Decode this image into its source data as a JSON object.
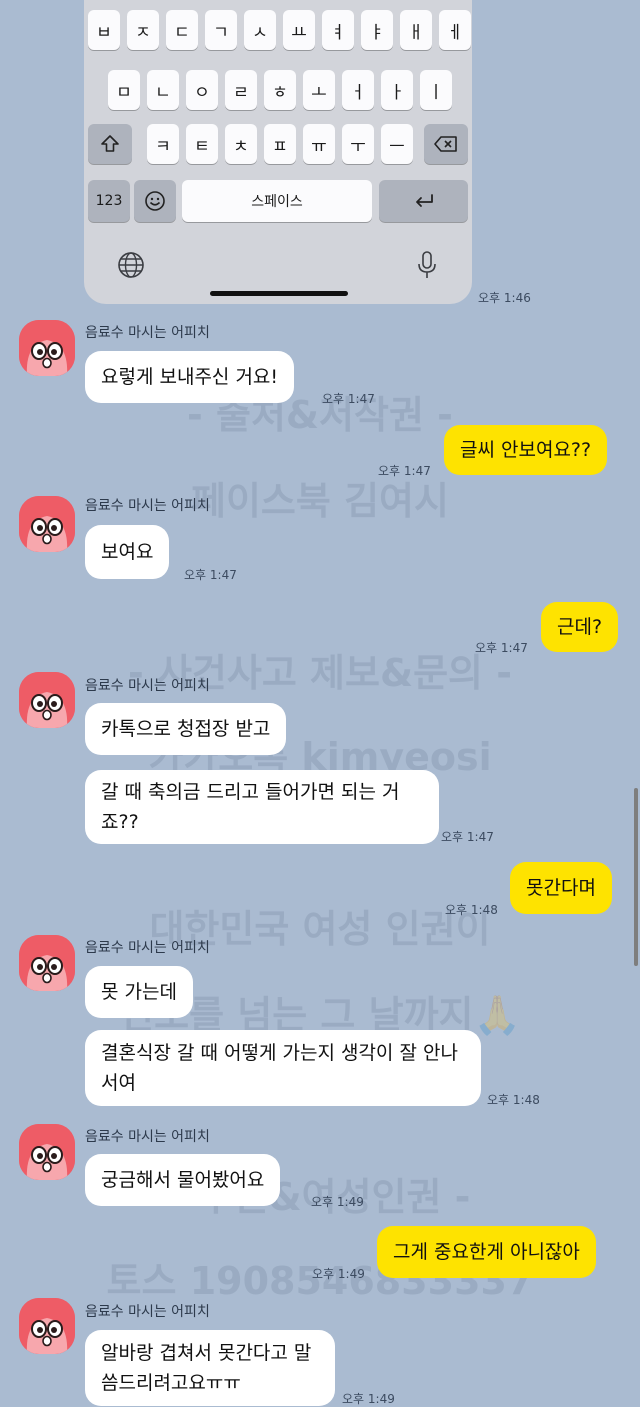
{
  "keyboard": {
    "row1": [
      "ㅂ",
      "ㅈ",
      "ㄷ",
      "ㄱ",
      "ㅅ",
      "ㅛ",
      "ㅕ",
      "ㅑ",
      "ㅐ",
      "ㅔ"
    ],
    "row2": [
      "ㅁ",
      "ㄴ",
      "ㅇ",
      "ㄹ",
      "ㅎ",
      "ㅗ",
      "ㅓ",
      "ㅏ",
      "ㅣ"
    ],
    "row3": [
      "ㅋ",
      "ㅌ",
      "ㅊ",
      "ㅍ",
      "ㅠ",
      "ㅜ",
      "ㅡ"
    ],
    "shift_icon": "shift-arrow-icon",
    "backspace_icon": "backspace-icon",
    "num_label": "123",
    "emoji_icon": "emoji-icon",
    "space_label": "스페이스",
    "return_icon": "return-icon",
    "globe_icon": "globe-icon",
    "mic_icon": "microphone-icon"
  },
  "sender_name": "음료수 마시는 어피치",
  "messages": {
    "t0": "오후 1:46",
    "m1": "요렇게 보내주신 거요!",
    "t1": "오후 1:47",
    "m2": "글씨 안보여요??",
    "t2": "오후 1:47",
    "m3": "보여요",
    "t3": "오후 1:47",
    "m4": "근데?",
    "t4": "오후 1:47",
    "m5": "카톡으로 청접장 받고",
    "m6": "갈 때 축의금 드리고 들어가면 되는 거죠??",
    "t6": "오후 1:47",
    "m7": "못간다며",
    "t7": "오후 1:48",
    "m8": "못 가는데",
    "m9": "결혼식장 갈 때 어떻게 가는지 생각이 잘 안나서여",
    "t9": "오후 1:48",
    "m10": "궁금해서 물어봤어요",
    "t10": "오후 1:49",
    "m11": "그게 중요한게 아니잖아",
    "t11": "오후 1:49",
    "m12": "알바랑 겹쳐서 못간다고 말씀드리려고요ㅠㅠ",
    "t12": "오후 1:49"
  },
  "watermarks": [
    "- 출처&저작권 -",
    "페이스북 김여시",
    "- 사건사고 제보&문의 -",
    "카카오톡 kimyeosi",
    "대한민국 여성 인권이",
    "인도를 넘는 그 날까지🙏",
    "- 후원&여성인권 -",
    "토스 1908546833337"
  ],
  "colors": {
    "background": "#aabbd1",
    "my_bubble": "#fee300",
    "their_bubble": "#ffffff",
    "avatar": "#ee5c66"
  }
}
